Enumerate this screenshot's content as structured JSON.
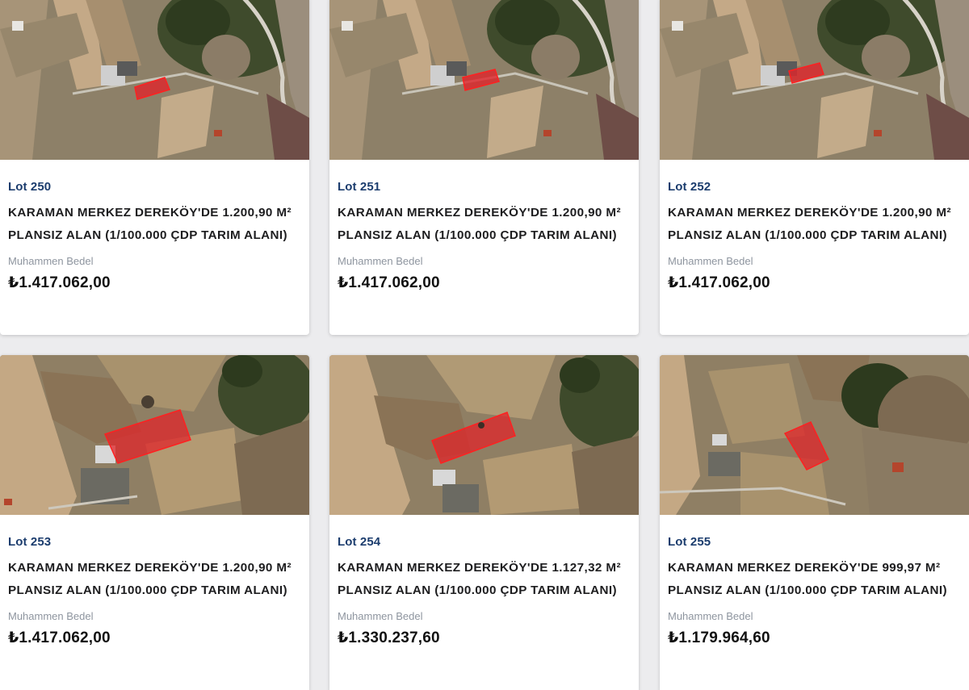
{
  "price_label": "Muhammen Bedel",
  "colors": {
    "lot_number": "#1c3d6e",
    "parcel_highlight": "#e0242a"
  },
  "lots": [
    {
      "lot": "Lot 250",
      "title_line1": "KARAMAN MERKEZ DEREKÖY'DE 1.200,90 M²",
      "title_line2": "PLANSIZ ALAN (1/100.000 ÇDP TARIM ALANI)",
      "price": "₺1.417.062,00"
    },
    {
      "lot": "Lot 251",
      "title_line1": "KARAMAN MERKEZ DEREKÖY'DE 1.200,90 M²",
      "title_line2": "PLANSIZ ALAN (1/100.000 ÇDP TARIM ALANI)",
      "price": "₺1.417.062,00"
    },
    {
      "lot": "Lot 252",
      "title_line1": "KARAMAN MERKEZ DEREKÖY'DE 1.200,90 M²",
      "title_line2": "PLANSIZ ALAN (1/100.000 ÇDP TARIM ALANI)",
      "price": "₺1.417.062,00"
    },
    {
      "lot": "Lot 253",
      "title_line1": "KARAMAN MERKEZ DEREKÖY'DE 1.200,90 M²",
      "title_line2": "PLANSIZ ALAN (1/100.000 ÇDP TARIM ALANI)",
      "price": "₺1.417.062,00"
    },
    {
      "lot": "Lot 254",
      "title_line1": "KARAMAN MERKEZ DEREKÖY'DE 1.127,32 M²",
      "title_line2": "PLANSIZ ALAN (1/100.000 ÇDP TARIM ALANI)",
      "price": "₺1.330.237,60"
    },
    {
      "lot": "Lot 255",
      "title_line1": "KARAMAN MERKEZ DEREKÖY'DE 999,97 M²",
      "title_line2": "PLANSIZ ALAN (1/100.000 ÇDP TARIM ALANI)",
      "price": "₺1.179.964,60"
    }
  ]
}
